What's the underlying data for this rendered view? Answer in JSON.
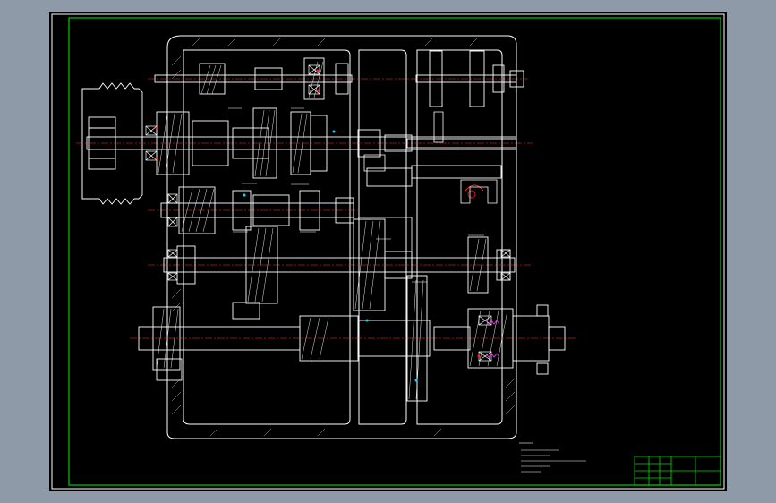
{
  "viewport": {
    "background": "#8f9aa9",
    "sheet_color": "#000000",
    "frame_color": "#00cc00"
  },
  "drawing": {
    "title": "",
    "colors": {
      "outline": "#ffffff",
      "hatch": "#ffffff",
      "centerline": "#ff3030",
      "title_block": "#00dd00",
      "accent_cyan": "#00e5ff",
      "accent_red": "#ff2020",
      "accent_magenta": "#ff40ff"
    }
  },
  "notes": {
    "heading": "",
    "lines": []
  },
  "title_block": {
    "cells": []
  }
}
